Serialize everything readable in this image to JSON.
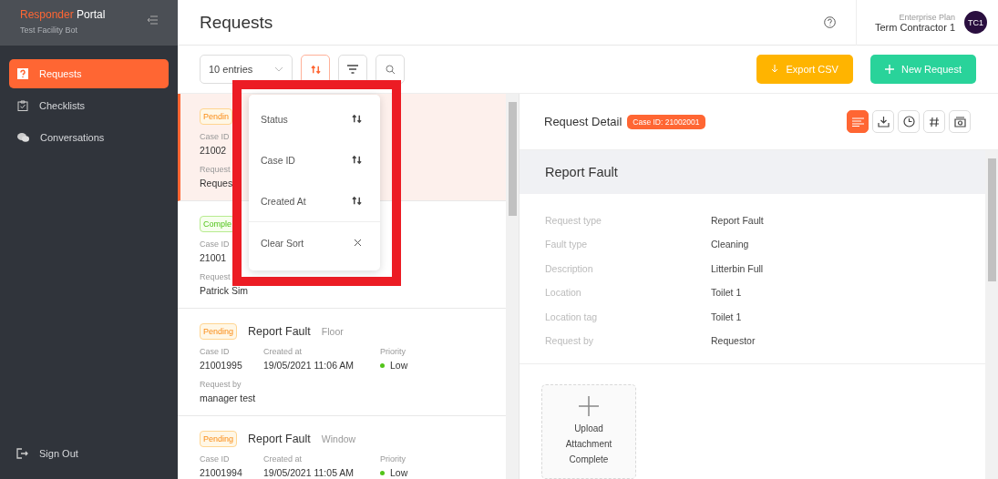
{
  "brand": {
    "first": "Responder",
    "second": "Portal",
    "subtitle": "Test Facility Bot"
  },
  "nav": [
    {
      "label": "Requests",
      "selected": true
    },
    {
      "label": "Checklists",
      "selected": false
    },
    {
      "label": "Conversations",
      "selected": false
    }
  ],
  "sign_out": "Sign Out",
  "page_title": "Requests",
  "user": {
    "plan": "Enterprise Plan",
    "name": "Term Contractor 1",
    "initials": "TC1"
  },
  "toolbar": {
    "entries": "10 entries",
    "sort_active": true,
    "export": "Export CSV",
    "new": "New Request"
  },
  "requests": [
    {
      "selected": true,
      "badge": {
        "label": "Pendin",
        "kind": "pending"
      },
      "fields": [
        {
          "label": "Case ID",
          "value": "21002"
        }
      ],
      "requester": {
        "label": "Request",
        "value": "Reques"
      }
    },
    {
      "selected": false,
      "badge": {
        "label": "Comple",
        "kind": "complete"
      },
      "fields": [
        {
          "label": "Case ID",
          "value": "21001"
        }
      ],
      "requester": {
        "label": "Request",
        "value": "Patrick Sim"
      }
    },
    {
      "selected": false,
      "badge": {
        "label": "Pending",
        "kind": "pending"
      },
      "title": "Report Fault",
      "category": "Floor",
      "fields": [
        {
          "label": "Case ID",
          "value": "21001995"
        },
        {
          "label": "Created at",
          "value": "19/05/2021 11:06 AM"
        },
        {
          "label": "Priority",
          "value": "Low",
          "kind": "priority"
        }
      ],
      "requester": {
        "label": "Request by",
        "value": "manager test"
      }
    },
    {
      "selected": false,
      "badge": {
        "label": "Pending",
        "kind": "pending"
      },
      "title": "Report Fault",
      "category": "Window",
      "fields": [
        {
          "label": "Case ID",
          "value": "21001994"
        },
        {
          "label": "Created at",
          "value": "19/05/2021 11:05 AM"
        },
        {
          "label": "Priority",
          "value": "Low",
          "kind": "priority"
        }
      ]
    }
  ],
  "sort_menu": {
    "items": [
      {
        "label": "Status",
        "kind": "sort"
      },
      {
        "label": "Case ID",
        "kind": "sort"
      },
      {
        "label": "Created At",
        "kind": "sort"
      },
      {
        "label": "Clear Sort",
        "kind": "clear"
      }
    ]
  },
  "detail": {
    "title": "Request Detail",
    "case_badge": "Case ID: 21002001",
    "tools": [
      {
        "selected": true
      },
      {
        "selected": false
      },
      {
        "selected": false
      },
      {
        "selected": false
      },
      {
        "selected": false
      }
    ],
    "heading": "Report Fault",
    "rows": [
      {
        "label": "Request type",
        "value": "Report Fault"
      },
      {
        "label": "Fault type",
        "value": "Cleaning"
      },
      {
        "label": "Description",
        "value": "Litterbin Full"
      },
      {
        "label": "Location",
        "value": "Toilet 1"
      },
      {
        "label": "Location tag",
        "value": "Toilet 1"
      },
      {
        "label": "Request by",
        "value": "Requestor"
      }
    ],
    "upload": "Upload Attachment Complete"
  }
}
